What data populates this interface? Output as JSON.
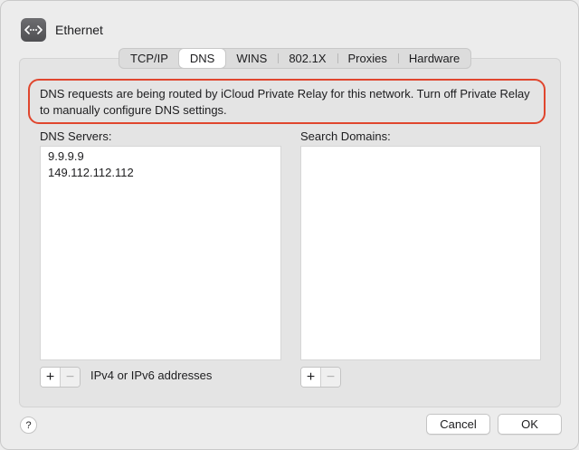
{
  "header": {
    "title": "Ethernet",
    "icon": "ethernet-arrows-icon"
  },
  "tabs": [
    {
      "label": "TCP/IP",
      "active": false
    },
    {
      "label": "DNS",
      "active": true
    },
    {
      "label": "WINS",
      "active": false
    },
    {
      "label": "802.1X",
      "active": false
    },
    {
      "label": "Proxies",
      "active": false
    },
    {
      "label": "Hardware",
      "active": false
    }
  ],
  "notice": {
    "text": "DNS requests are being routed by iCloud Private Relay for this network. Turn off Private Relay to manually configure DNS settings.",
    "border_color": "#e0462e"
  },
  "dns_servers": {
    "label": "DNS Servers:",
    "items": [
      "9.9.9.9",
      "149.112.112.112"
    ],
    "add_label": "+",
    "remove_label": "−",
    "hint": "IPv4 or IPv6 addresses"
  },
  "search_domains": {
    "label": "Search Domains:",
    "items": [],
    "add_label": "+",
    "remove_label": "−"
  },
  "footer": {
    "help_label": "?",
    "cancel_label": "Cancel",
    "ok_label": "OK"
  }
}
